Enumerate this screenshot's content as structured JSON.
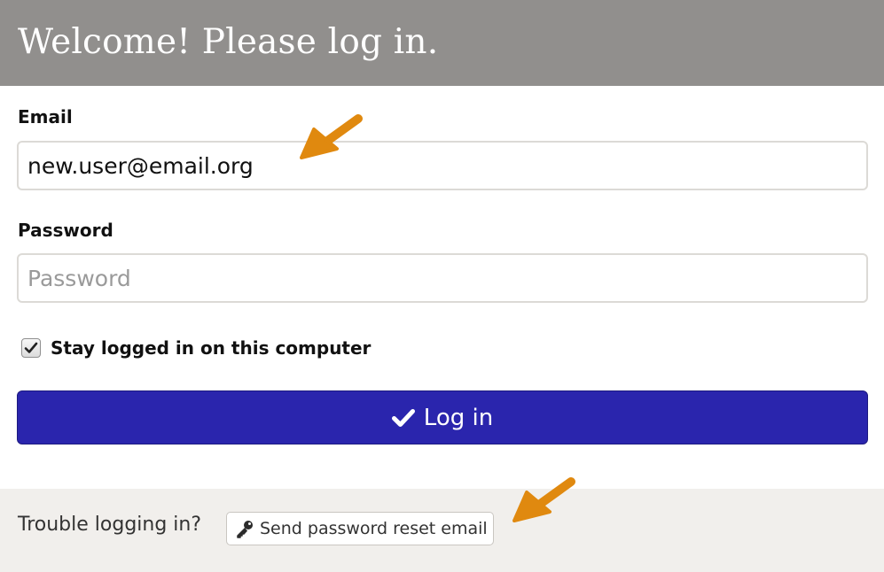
{
  "header": {
    "title": "Welcome! Please log in."
  },
  "email": {
    "label": "Email",
    "value": "new.user@email.org"
  },
  "password": {
    "label": "Password",
    "placeholder": "Password"
  },
  "remember": {
    "label": "Stay logged in on this computer",
    "checked": true
  },
  "login_button": {
    "label": "Log in"
  },
  "footer": {
    "trouble_text": "Trouble logging in?",
    "reset_button_label": "Send password reset email"
  },
  "colors": {
    "header_bg": "#918f8d",
    "primary_button": "#2a25ad",
    "annotation_arrow": "#e0890f",
    "footer_bg": "#f1efec"
  }
}
